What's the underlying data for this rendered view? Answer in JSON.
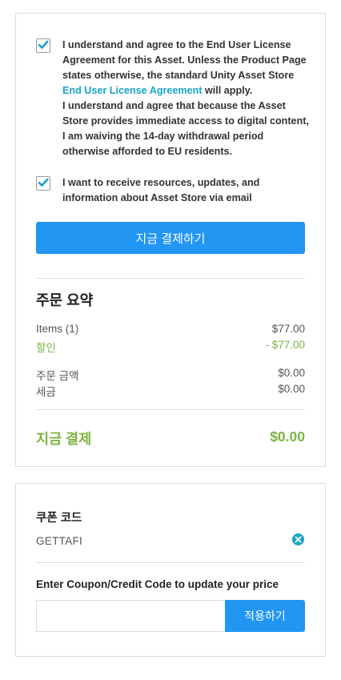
{
  "consent": {
    "eula": {
      "checked": true,
      "text_before_link": "I understand and agree to the End User License Agreement for this Asset. Unless the Product Page states otherwise, the standard Unity Asset Store ",
      "link": "End User License Agreement",
      "text_after_link": " will apply.",
      "text_second": "I understand and agree that because the Asset Store provides immediate access to digital content, I am waiving the 14-day withdrawal period otherwise afforded to EU residents."
    },
    "newsletter": {
      "checked": true,
      "text": "I want to receive resources, updates, and information about Asset Store via email"
    }
  },
  "pay_button": "지금 결제하기",
  "summary": {
    "title": "주문 요약",
    "items_label": "Items (1)",
    "items_value": "$77.00",
    "discount_label": "할인",
    "discount_value": "- $77.00",
    "order_amount_label": "주문 금액",
    "order_amount_value": "$0.00",
    "tax_label": "세금",
    "tax_value": "$0.00",
    "total_label": "지금 결제",
    "total_value": "$0.00"
  },
  "coupon": {
    "title": "쿠폰 코드",
    "applied_code": "GETTAFI",
    "instruction": "Enter Coupon/Credit Code to update your price",
    "input_value": "",
    "apply_button": "적용하기"
  },
  "colors": {
    "primary": "#2196f3",
    "link": "#18a4c8",
    "green": "#7cb342"
  }
}
